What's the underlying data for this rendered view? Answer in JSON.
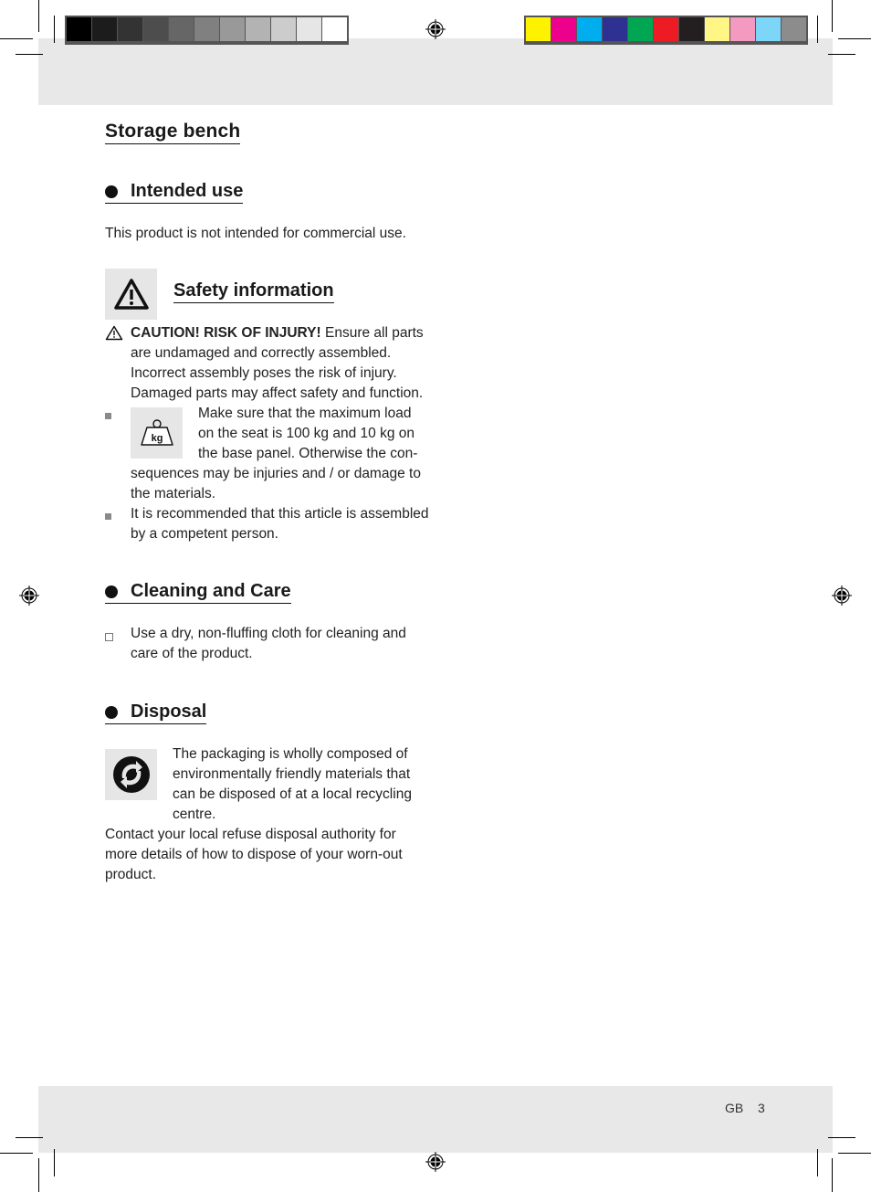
{
  "print_marks": {
    "grayscale_swatches": [
      "#000000",
      "#1c1c1c",
      "#333333",
      "#4d4d4d",
      "#666666",
      "#808080",
      "#999999",
      "#b3b3b3",
      "#cccccc",
      "#e6e6e6",
      "#ffffff"
    ],
    "color_swatches": [
      "#fff200",
      "#ec008c",
      "#00aeef",
      "#2e3192",
      "#00a651",
      "#ed1c24",
      "#231f20",
      "#fff685",
      "#f49ac1",
      "#7dd5f7",
      "#8c8c8c"
    ]
  },
  "document": {
    "title": "Storage bench",
    "sections": {
      "intended_use": {
        "heading": "Intended use",
        "text": "This product is not intended for commercial use."
      },
      "safety": {
        "heading": "Safety information",
        "caution_label": "CAUTION! RISK OF INJURY!",
        "caution_text": " Ensure all parts are undamaged and correctly assembled. Incorrect assembly poses the risk of injury. Damaged parts may affect safety and function.",
        "load_icon_label": "kg",
        "load_text_a": "Make sure that the maximum load on the seat is 100 kg and 10 kg on the base panel. Otherwise the con-",
        "load_text_b": "sequences may be injuries and / or damage to the materials.",
        "assembly_text": "It is recommended that this article is assembled by a competent person."
      },
      "cleaning": {
        "heading": "Cleaning and Care",
        "text": "Use a dry, non-fluffing cloth for cleaning and care of the product."
      },
      "disposal": {
        "heading": "Disposal",
        "packaging_text": "The packaging is wholly composed of environmentally friendly materials that can be disposed of at a local recycling centre.",
        "contact_text": "Contact your local refuse disposal authority for more details of how to dispose of your worn-out product."
      }
    }
  },
  "footer": {
    "language": "GB",
    "page_number": "3"
  }
}
